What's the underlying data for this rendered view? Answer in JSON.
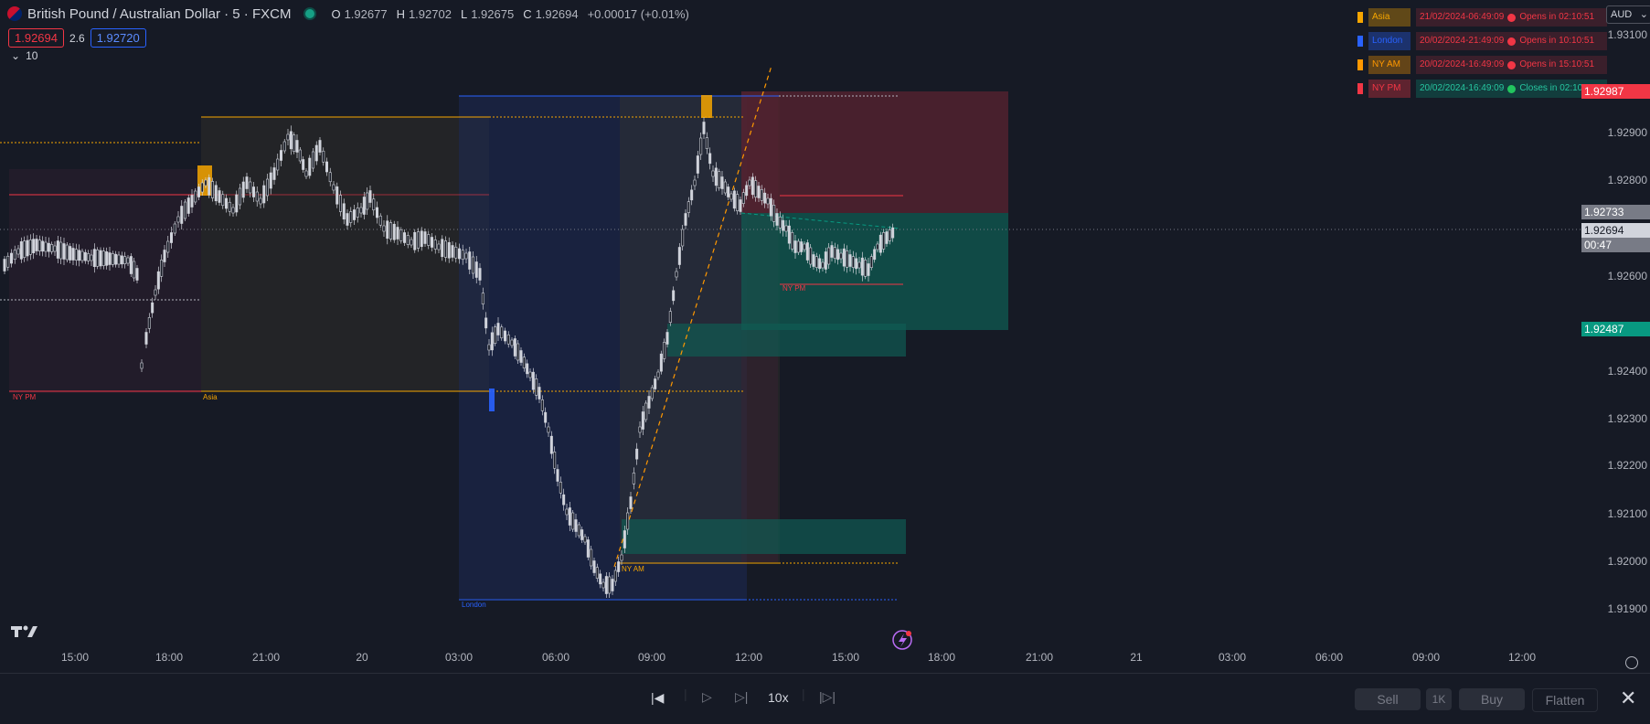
{
  "header": {
    "symbol_title": "British Pound / Australian Dollar · 5 · FXCM",
    "ohlc": [
      {
        "key": "O",
        "value": "1.92677"
      },
      {
        "key": "H",
        "value": "1.92702"
      },
      {
        "key": "L",
        "value": "1.92675"
      },
      {
        "key": "C",
        "value": "1.92694"
      }
    ],
    "change": "+0.00017 (+0.01%)"
  },
  "price_boxes": {
    "sell": "1.92694",
    "spread": "2.6",
    "buy": "1.92720"
  },
  "indicator_toggle": {
    "label": "10"
  },
  "currency": "AUD",
  "price_axis": {
    "labels": [
      "1.93100",
      "1.92900",
      "1.92800",
      "1.92600",
      "1.92400",
      "1.92300",
      "1.92200",
      "1.92100",
      "1.92000",
      "1.91900"
    ],
    "tags": [
      {
        "value": "1.92987",
        "color": "#f23645"
      },
      {
        "value": "1.92733",
        "color": "#787b86"
      },
      {
        "value": "1.92694",
        "color": "#d1d4dc",
        "countdown": "00:47"
      },
      {
        "value": "1.92487",
        "color": "#089981"
      }
    ]
  },
  "time_axis": {
    "labels": [
      "15:00",
      "18:00",
      "21:00",
      "20",
      "03:00",
      "06:00",
      "09:00",
      "12:00",
      "15:00",
      "18:00",
      "21:00",
      "21",
      "03:00",
      "06:00",
      "09:00",
      "12:00"
    ]
  },
  "sessions": [
    {
      "name": "Asia",
      "color": "#f7a600",
      "time": "21/02/2024-06:49:09",
      "status": "Opens in 02:10:51",
      "state": "closed"
    },
    {
      "name": "London",
      "color": "#2962ff",
      "time": "20/02/2024-21:49:09",
      "status": "Opens in 10:10:51",
      "state": "closed"
    },
    {
      "name": "NY AM",
      "color": "#ff9800",
      "time": "20/02/2024-16:49:09",
      "status": "Opens in 15:10:51",
      "state": "closed"
    },
    {
      "name": "NY PM",
      "color": "#f23645",
      "time": "20/02/2024-16:49:09",
      "status": "Closes in 02:10:51",
      "state": "open"
    }
  ],
  "chart_labels": {
    "ny_pm": "NY PM",
    "asia": "Asia",
    "london": "London",
    "ny_am": "NY AM",
    "ny_pm_2": "NY PM"
  },
  "bottom_toolbar": {
    "speed": "10x",
    "sell": "Sell",
    "qty": "1K",
    "buy": "Buy",
    "flatten": "Flatten"
  },
  "colors": {
    "background": "#161a25",
    "up": "#089981",
    "down": "#f23645",
    "london": "#2962ff",
    "asia": "#f7a600"
  }
}
